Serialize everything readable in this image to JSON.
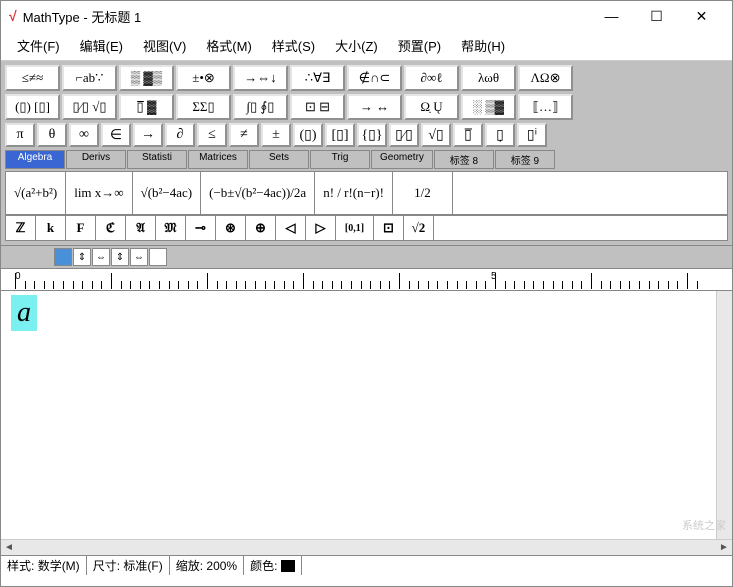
{
  "window": {
    "app_name": "MathType",
    "doc_title": "无标题 1",
    "separator": " - "
  },
  "menus": [
    "文件(F)",
    "编辑(E)",
    "视图(V)",
    "格式(M)",
    "样式(S)",
    "大小(Z)",
    "预置(P)",
    "帮助(H)"
  ],
  "palette_row1": [
    "≤≠≈",
    "⌐ab∵",
    "▒ ▓▒",
    "±•⊗",
    "→⇔↓",
    "∴∀∃",
    "∉∩⊂",
    "∂∞ℓ",
    "λωθ",
    "ΛΩ⊗"
  ],
  "palette_row2": [
    "(▯) [▯]",
    "▯⁄▯ √▯",
    "▯̅ ▓",
    "ΣΣ▯",
    "∫▯ ∮▯",
    "⊡ ⊟",
    "→ ↔",
    "Ω̣ Ų",
    "░ ▒▓",
    "⟦…⟧"
  ],
  "palette_row3": [
    "π",
    "θ",
    "∞",
    "∈",
    "→",
    "∂",
    "≤",
    "≠",
    "±",
    "(▯)",
    "[▯]",
    "{▯}",
    "▯⁄▯",
    "√▯",
    "▯̅",
    "▯̣",
    "▯ⁱ"
  ],
  "tabs": [
    "Algebra",
    "Derivs",
    "Statisti",
    "Matrices",
    "Sets",
    "Trig",
    "Geometry",
    "标签 8",
    "标签 9"
  ],
  "template_list": [
    "√(a²+b²)",
    "lim x→∞",
    "√(b²−4ac)",
    "(−b±√(b²−4ac))/2a",
    "n! / r!(n−r)!",
    "1/2"
  ],
  "template_list2": [
    "ℤ",
    "k",
    "F",
    "ℭ",
    "𝔄",
    "𝔐",
    "⊸",
    "⊛",
    "⊕",
    "◁",
    "▷",
    "[0,1]",
    "⊡",
    "√2"
  ],
  "mini_tools": [
    "",
    "↕",
    "↔",
    "↕",
    "↔",
    ""
  ],
  "ruler": {
    "zero": "0",
    "five": "5"
  },
  "editor": {
    "content": "a"
  },
  "status": {
    "style_label": "样式:",
    "style_value": "数学(M)",
    "size_label": "尺寸:",
    "size_value": "标准(F)",
    "zoom_label": "缩放:",
    "zoom_value": "200%",
    "color_label": "颜色:"
  },
  "watermark": "系统之家"
}
